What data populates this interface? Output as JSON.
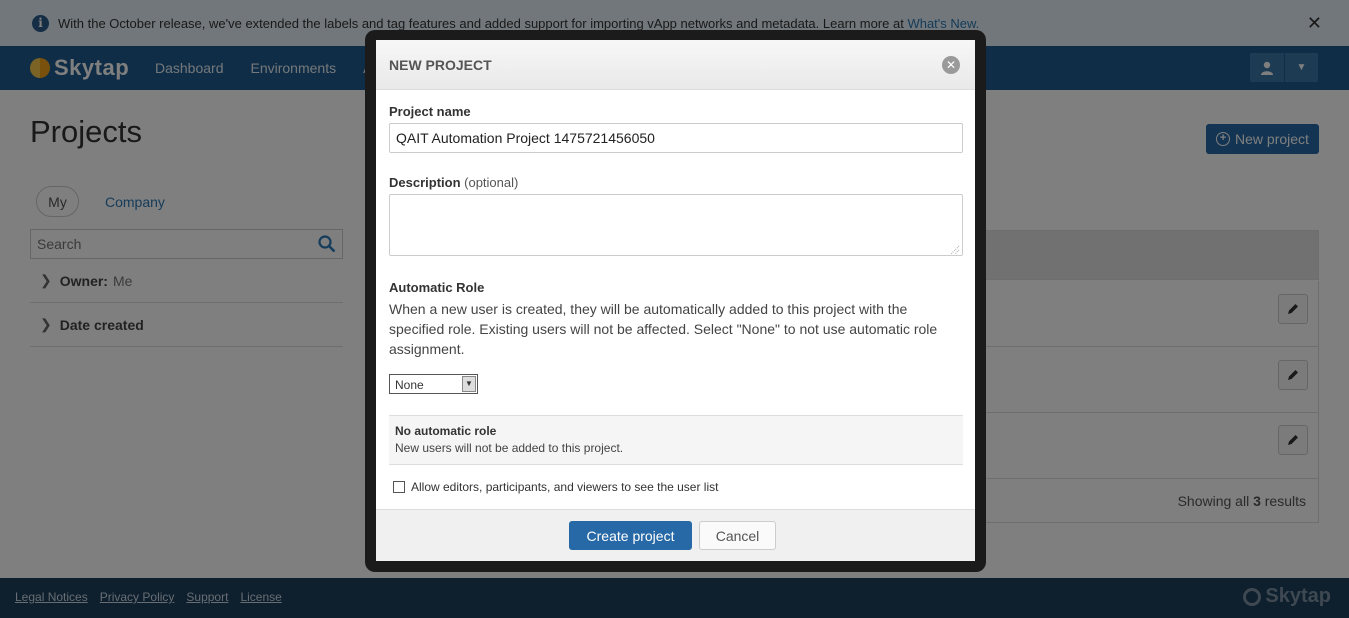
{
  "notice": {
    "text": "With the October release, we've extended the labels and tag features and added support for importing vApp networks and metadata. Learn more at ",
    "link": "What's New."
  },
  "nav": {
    "brand": "Skytap",
    "links": [
      "Dashboard",
      "Environments",
      "As"
    ]
  },
  "page": {
    "title": "Projects",
    "new_project_label": "New project",
    "tabs": {
      "my": "My",
      "company": "Company"
    },
    "search_placeholder": "Search",
    "filters": [
      {
        "label": "Owner:",
        "value": "Me"
      },
      {
        "label": "Date created",
        "value": ""
      }
    ],
    "results": {
      "prefix": "Showing all ",
      "count": "3",
      "suffix": " results"
    }
  },
  "modal": {
    "title": "NEW PROJECT",
    "project_name_label": "Project name",
    "project_name_value": "QAIT Automation Project 1475721456050",
    "description_label": "Description",
    "description_optional": "(optional)",
    "automatic_role_label": "Automatic Role",
    "automatic_role_desc": "When a new user is created, they will be automatically added to this project with the specified role. Existing users will not be affected. Select \"None\" to not use automatic role assignment.",
    "role_selected": "None",
    "role_box_title": "No automatic role",
    "role_box_desc": "New users will not be added to this project.",
    "checkbox_label": "Allow editors, participants, and viewers to see the user list",
    "create_label": "Create project",
    "cancel_label": "Cancel"
  },
  "footer": {
    "links": [
      "Legal Notices",
      "Privacy Policy",
      "Support",
      "License"
    ],
    "brand": "Skytap"
  },
  "colors": {
    "nav": "#1e5a8c",
    "primary_button": "#2669a6",
    "footer": "#1d3f5c"
  }
}
